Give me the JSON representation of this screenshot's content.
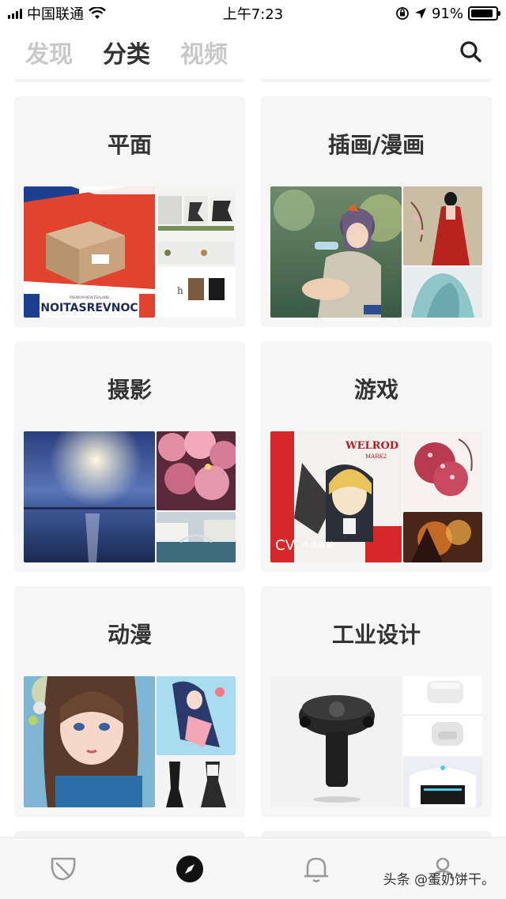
{
  "status_bar": {
    "carrier": "中国联通",
    "time": "上午7:23",
    "battery": "91%",
    "battery_level": 0.91
  },
  "tabs": [
    {
      "label": "发现",
      "active": false
    },
    {
      "label": "分类",
      "active": true
    },
    {
      "label": "视频",
      "active": false
    }
  ],
  "categories": [
    {
      "title": "平面"
    },
    {
      "title": "插画/漫画"
    },
    {
      "title": "摄影"
    },
    {
      "title": "游戏"
    },
    {
      "title": "动漫"
    },
    {
      "title": "工业设计"
    }
  ],
  "thumb_text": {
    "graphic_banner": "NOITASREVNOC",
    "graphic_subbanner": "PREMIUM NEW ZEALAND",
    "game_title": "WELROD",
    "game_subtitle": "MARK2",
    "game_cv": "CV",
    "game_cv_name": "今井麻美"
  },
  "bottom_nav": [
    {
      "icon": "leaf-icon"
    },
    {
      "icon": "compass-icon"
    },
    {
      "icon": "bell-icon"
    },
    {
      "icon": "profile-icon"
    }
  ],
  "watermark": "头条 @蛋奶饼干。",
  "colors": {
    "accent": "#222222",
    "inactive_tab": "#c8c8c8",
    "card_bg": "#f6f6f6"
  }
}
